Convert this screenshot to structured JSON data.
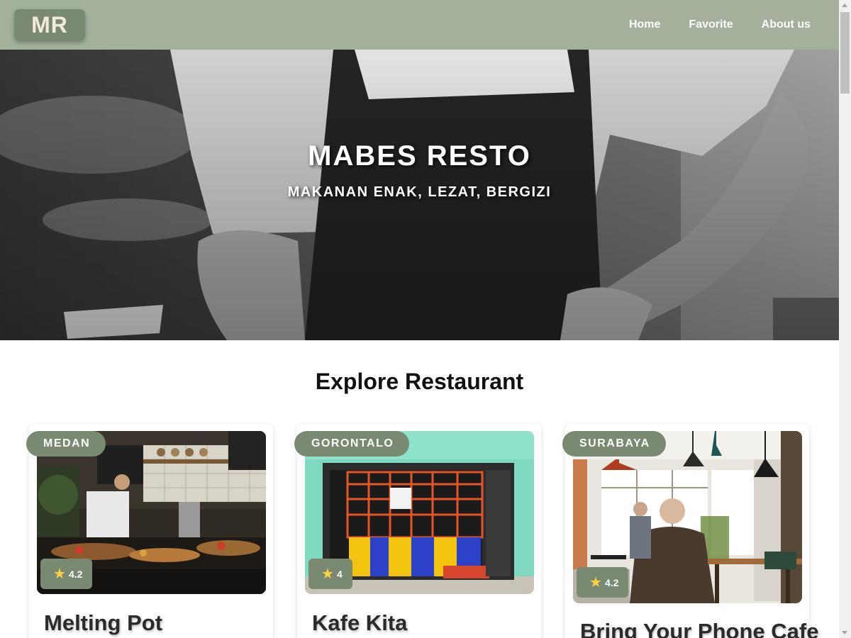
{
  "navbar": {
    "logo": "MR",
    "links": [
      "Home",
      "Favorite",
      "About us"
    ]
  },
  "hero": {
    "title": "MABES RESTO",
    "tagline": "MAKANAN ENAK, LEZAT, BERGIZI"
  },
  "explore": {
    "title": "Explore Restaurant",
    "restaurants": [
      {
        "city": "MEDAN",
        "rating": "4.2",
        "name": "Melting Pot"
      },
      {
        "city": "GORONTALO",
        "rating": "4",
        "name": "Kafe Kita"
      },
      {
        "city": "SURABAYA",
        "rating": "4.2",
        "name": "Bring Your Phone Cafe"
      }
    ]
  },
  "icons": {
    "star": "star-icon"
  },
  "colors": {
    "navbar": "#a3b09c",
    "badge": "#7a8a72",
    "logo_text": "#f4ead8",
    "star": "#ffd23f"
  }
}
